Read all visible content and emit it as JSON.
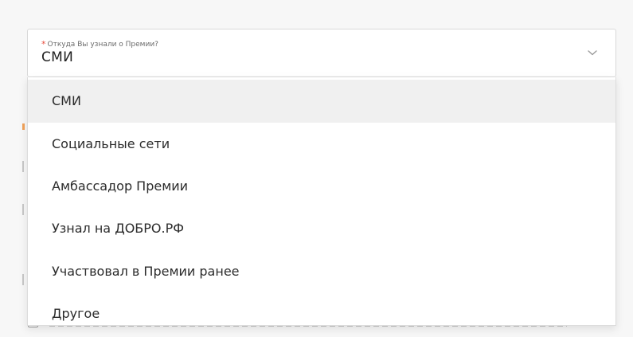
{
  "field": {
    "required_marker": "*",
    "label": "Откуда Вы узнали о Премии?",
    "value": "СМИ",
    "chevron_icon": "chevron-down-icon"
  },
  "dropdown": {
    "options": [
      {
        "label": "СМИ",
        "selected": true
      },
      {
        "label": "Социальные сети",
        "selected": false
      },
      {
        "label": "Амбассадор Премии",
        "selected": false
      },
      {
        "label": "Узнал на ДОБРО.РФ",
        "selected": false
      },
      {
        "label": "Участвовал в Премии ранее",
        "selected": false
      },
      {
        "label": "Другое",
        "selected": false
      }
    ]
  },
  "colors": {
    "required": "#e74c3c",
    "selected_bg": "#f0f0f0",
    "border": "#d9d9d9"
  }
}
